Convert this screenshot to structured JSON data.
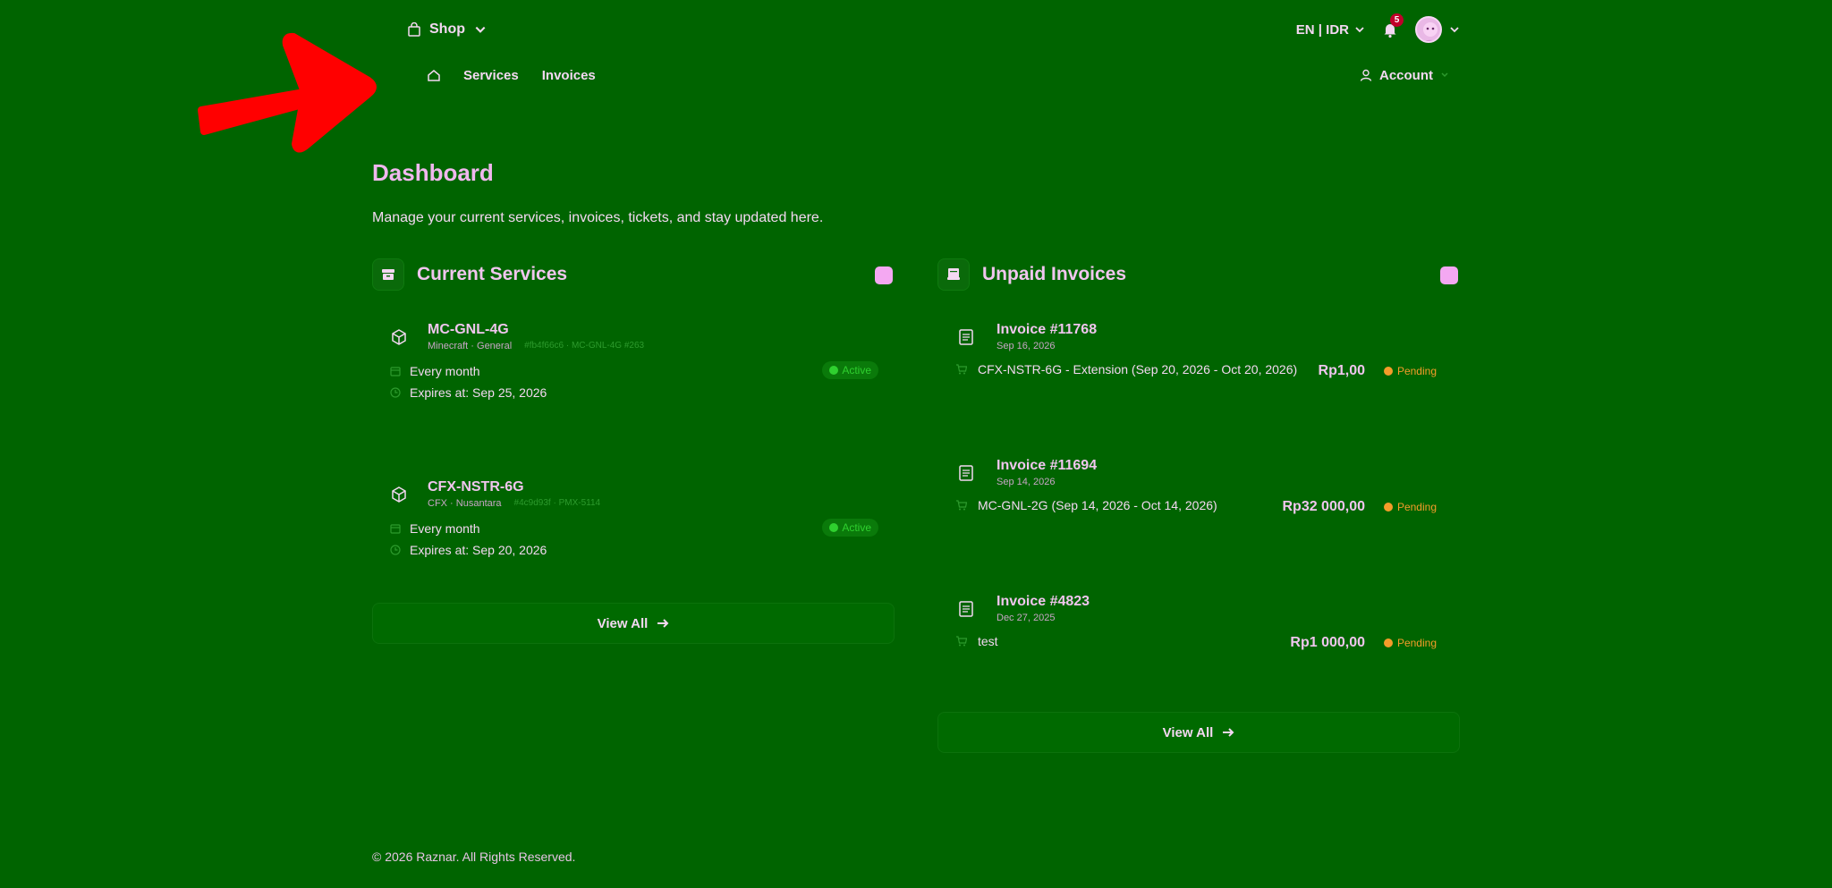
{
  "topbar": {
    "shop_label": "Shop",
    "lang_label": "EN | IDR",
    "notification_count": "5"
  },
  "nav": {
    "items": [
      {
        "label": "Services"
      },
      {
        "label": "Invoices"
      }
    ],
    "account_label": "Account"
  },
  "page": {
    "title": "Dashboard",
    "subtitle": "Manage your current services, invoices, tickets, and stay updated here."
  },
  "services": {
    "title": "Current Services",
    "items": [
      {
        "name": "MC-GNL-4G",
        "category": "Minecraft · General",
        "id": "#fb4f66c6 · MC-GNL-4G #263",
        "status": "Active",
        "billing": "Every month",
        "expires": "Expires at: Sep 25, 2026"
      },
      {
        "name": "CFX-NSTR-6G",
        "category": "CFX · Nusantara",
        "id": "#4c9d93f · PMX-5114",
        "status": "Active",
        "billing": "Every month",
        "expires": "Expires at: Sep 20, 2026"
      }
    ],
    "view_all": "View All"
  },
  "invoices": {
    "title": "Unpaid Invoices",
    "items": [
      {
        "name": "Invoice #11768",
        "date": "Sep 16, 2026",
        "amount": "Rp1,00",
        "status": "Pending",
        "line": "CFX-NSTR-6G - Extension (Sep 20, 2026 - Oct 20, 2026)"
      },
      {
        "name": "Invoice #11694",
        "date": "Sep 14, 2026",
        "amount": "Rp32 000,00",
        "status": "Pending",
        "line": "MC-GNL-2G (Sep 14, 2026 - Oct 14, 2026)"
      },
      {
        "name": "Invoice #4823",
        "date": "Dec 27, 2025",
        "amount": "Rp1 000,00",
        "status": "Pending",
        "line": "test"
      }
    ],
    "view_all": "View All"
  },
  "footer": {
    "copyright": "© 2026 Raznar. All Rights Reserved."
  },
  "colors": {
    "background": "#006400",
    "annotation_arrow": "#ff0000",
    "text_pink": "#f0c6ee",
    "active_green": "#2fd02f",
    "pending_orange": "#f59c2a"
  }
}
